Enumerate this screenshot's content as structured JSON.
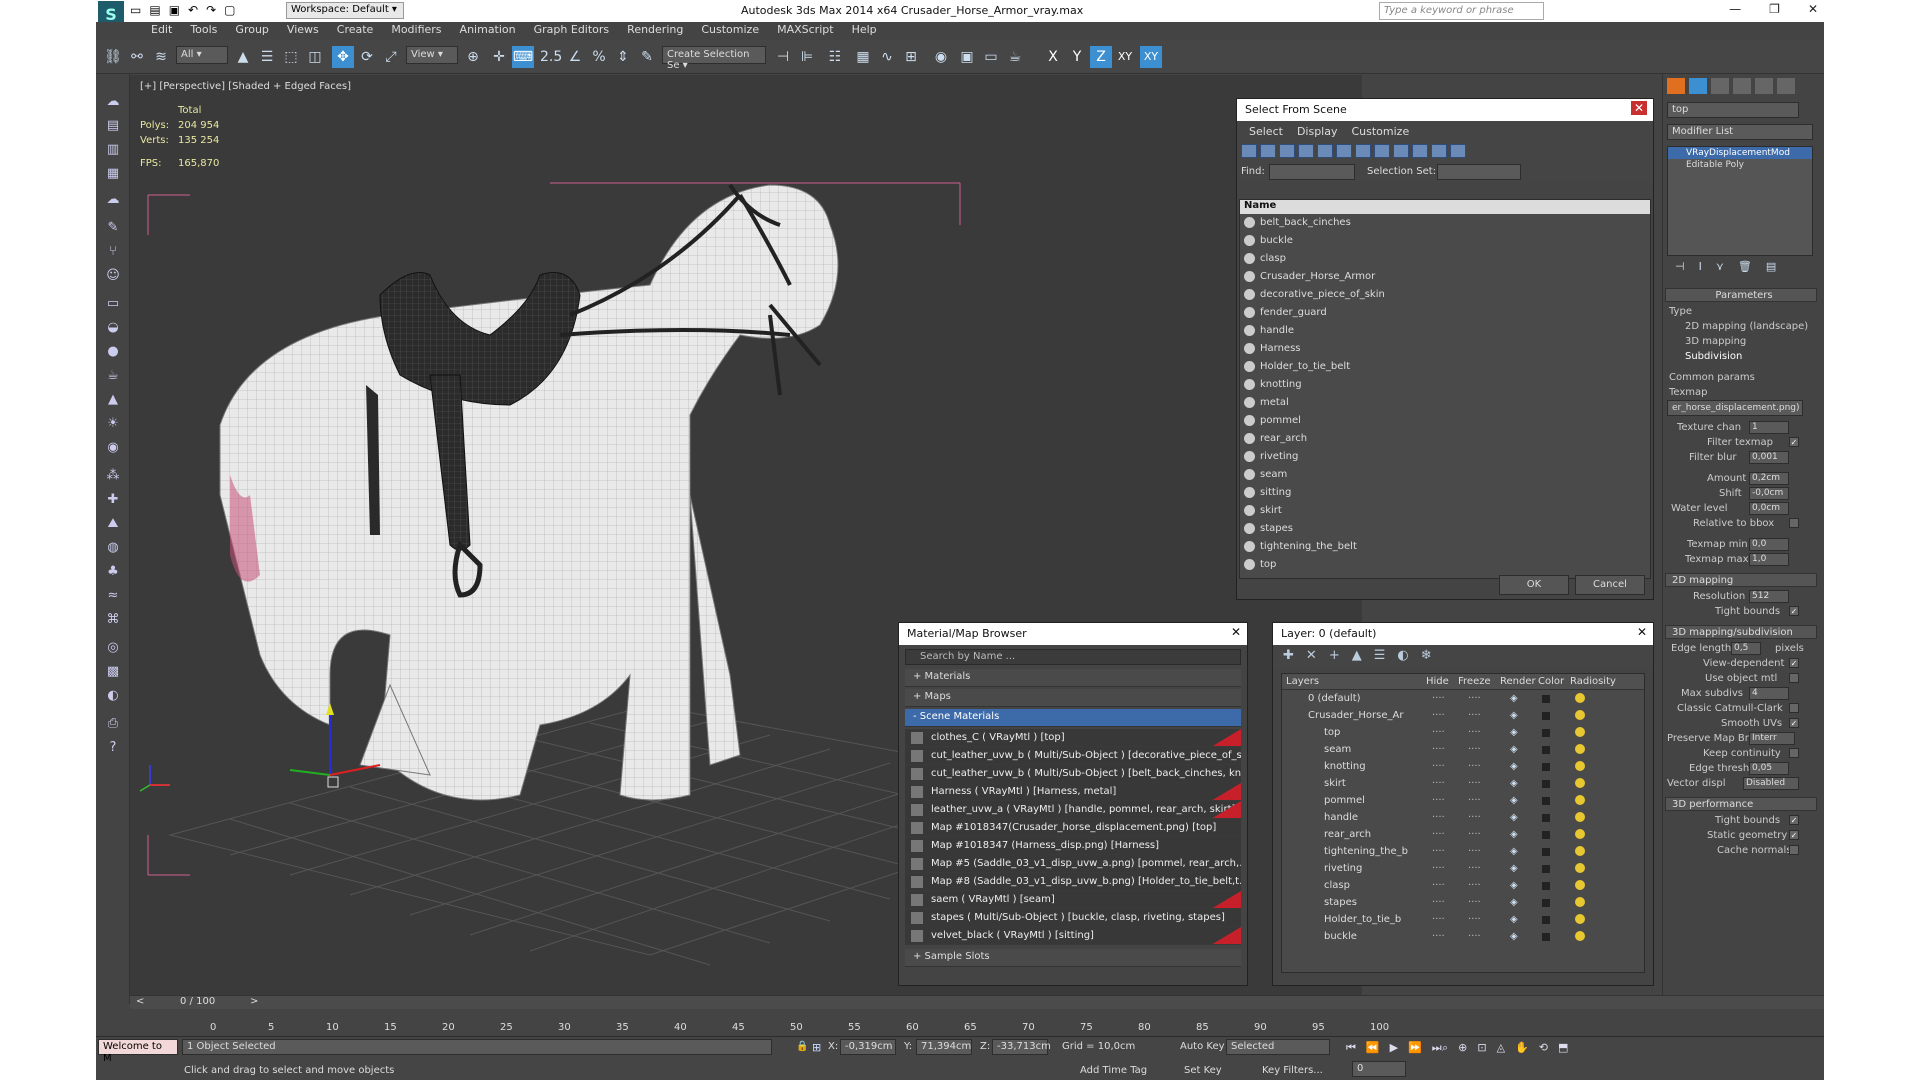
{
  "app": {
    "title": "Autodesk 3ds Max  2014 x64     Crusader_Horse_Armor_vray.max",
    "workspace": "Workspace: Default",
    "search_placeholder": "Type a keyword or phrase"
  },
  "menu": [
    "Edit",
    "Tools",
    "Group",
    "Views",
    "Create",
    "Modifiers",
    "Animation",
    "Graph Editors",
    "Rendering",
    "Customize",
    "MAXScript",
    "Help"
  ],
  "toolbar": {
    "filter": "All",
    "refcoord": "View",
    "selection_set": "Create Selection Se",
    "snap_label": "2.5",
    "axis_x": "X",
    "axis_y": "Y",
    "axis_z": "Z",
    "axis_xy": "XY",
    "axis_xy2": "XY"
  },
  "viewport": {
    "label": "[+] [Perspective] [Shaded + Edged Faces]",
    "stats": {
      "header": "Total",
      "polys_label": "Polys:",
      "polys": "204 954",
      "verts_label": "Verts:",
      "verts": "135 254",
      "fps_label": "FPS:",
      "fps": "165,870"
    }
  },
  "select_from_scene": {
    "title": "Select From Scene",
    "menu": [
      "Select",
      "Display",
      "Customize"
    ],
    "find_label": "Find:",
    "selset_label": "Selection Set:",
    "column": "Name",
    "items": [
      "belt_back_cinches",
      "buckle",
      "clasp",
      "Crusader_Horse_Armor",
      "decorative_piece_of_skin",
      "fender_guard",
      "handle",
      "Harness",
      "Holder_to_tie_belt",
      "knotting",
      "metal",
      "pommel",
      "rear_arch",
      "riveting",
      "seam",
      "sitting",
      "skirt",
      "stapes",
      "tightening_the_belt",
      "top"
    ],
    "ok": "OK",
    "cancel": "Cancel"
  },
  "material_browser": {
    "title": "Material/Map Browser",
    "search": "Search by Name ...",
    "sections": [
      "+ Materials",
      "+ Maps",
      "- Scene Materials"
    ],
    "items": [
      {
        "text": "clothes_C  ( VRayMtl ) [top]",
        "red": true
      },
      {
        "text": "cut_leather_uvw_b  ( Multi/Sub-Object ) [decorative_piece_of_s...",
        "red": false
      },
      {
        "text": "cut_leather_uvw_b  ( Multi/Sub-Object ) [belt_back_cinches, kn...",
        "red": false
      },
      {
        "text": "Harness  ( VRayMtl ) [Harness, metal]",
        "red": true
      },
      {
        "text": "leather_uvw_a  ( VRayMtl ) [handle, pommel, rear_arch, skirt]",
        "red": true
      },
      {
        "text": "Map #1018347(Crusader_horse_displacement.png) [top]",
        "red": false
      },
      {
        "text": "Map #1018347 (Harness_disp.png) [Harness]",
        "red": false
      },
      {
        "text": "Map #5 (Saddle_03_v1_disp_uvw_a.png) [pommel, rear_arch,...",
        "red": false
      },
      {
        "text": "Map #8 (Saddle_03_v1_disp_uvw_b.png) [Holder_to_tie_belt,t...",
        "red": false
      },
      {
        "text": "saem  ( VRayMtl ) [seam]",
        "red": true
      },
      {
        "text": "stapes  ( Multi/Sub-Object ) [buckle, clasp, riveting, stapes]",
        "red": false
      },
      {
        "text": "velvet_black  ( VRayMtl ) [sitting]",
        "red": true
      }
    ],
    "sample_slots": "+ Sample Slots"
  },
  "layers": {
    "title": "Layer: 0 (default)",
    "columns": [
      "Layers",
      "Hide",
      "Freeze",
      "Render",
      "Color",
      "Radiosity"
    ],
    "rows": [
      "0 (default)",
      "Crusader_Horse_Ar",
      "top",
      "seam",
      "knotting",
      "skirt",
      "pommel",
      "handle",
      "rear_arch",
      "tightening_the_b",
      "riveting",
      "clasp",
      "stapes",
      "Holder_to_tie_b",
      "buckle"
    ]
  },
  "command_panel": {
    "search": "top",
    "modifier_list": "Modifier List",
    "stack": [
      "VRayDisplacementMod",
      "Editable Poly"
    ],
    "parameters": "Parameters",
    "type_label": "Type",
    "types": [
      "2D mapping (landscape)",
      "3D mapping",
      "Subdivision"
    ],
    "common_params": "Common params",
    "texmap": "Texmap",
    "texmap_value": "er_horse_displacement.png)",
    "texture_chan_label": "Texture chan",
    "texture_chan": "1",
    "filter_texmap": "Filter texmap",
    "filter_blur_label": "Filter blur",
    "filter_blur": "0,001",
    "amount_label": "Amount",
    "amount": "0,2cm",
    "shift_label": "Shift",
    "shift": "-0,0cm",
    "water_label": "Water level",
    "water": "0,0cm",
    "relative_bbox": "Relative to bbox",
    "texmap_min_label": "Texmap min",
    "texmap_min": "0,0",
    "texmap_max_label": "Texmap max",
    "texmap_max": "1,0",
    "mapping2d": "2D mapping",
    "resolution_label": "Resolution",
    "resolution": "512",
    "tight_bounds": "Tight bounds",
    "mapping3d": "3D mapping/subdivision",
    "edge_length_label": "Edge length",
    "edge_length": "0,5",
    "pixels": "pixels",
    "view_dependent": "View-dependent",
    "use_object_mtl": "Use object mtl",
    "max_subdivs_label": "Max subdivs",
    "max_subdivs": "4",
    "classic_cc": "Classic Catmull-Clark",
    "smooth_uvs": "Smooth UVs",
    "preserve_label": "Preserve Map Bnd",
    "preserve": "Interr",
    "keep_continuity": "Keep continuity",
    "edge_thresh_label": "Edge thresh",
    "edge_thresh": "0,05",
    "vector_label": "Vector displ",
    "vector": "Disabled",
    "perf": "3D performance",
    "tight_bounds2": "Tight bounds",
    "static_geometry": "Static geometry",
    "cache_normals": "Cache normals"
  },
  "timeline": {
    "frame": "0 / 100",
    "ticks": [
      "0",
      "5",
      "10",
      "15",
      "20",
      "25",
      "30",
      "35",
      "40",
      "45",
      "50",
      "55",
      "60",
      "65",
      "70",
      "75",
      "80",
      "85",
      "90",
      "95",
      "100"
    ]
  },
  "status": {
    "maxscript": "Welcome to M",
    "selected": "1 Object Selected",
    "prompt": "Click and drag to select and move objects",
    "x": "-0,319cm",
    "y": "71,394cm",
    "z": "-33,713cm",
    "grid": "Grid = 10,0cm",
    "auto_key": "Auto Key",
    "selected_dd": "Selected",
    "set_key": "Set Key",
    "key_filters": "Key Filters...",
    "add_time_tag": "Add Time Tag",
    "frame_field": "0"
  }
}
